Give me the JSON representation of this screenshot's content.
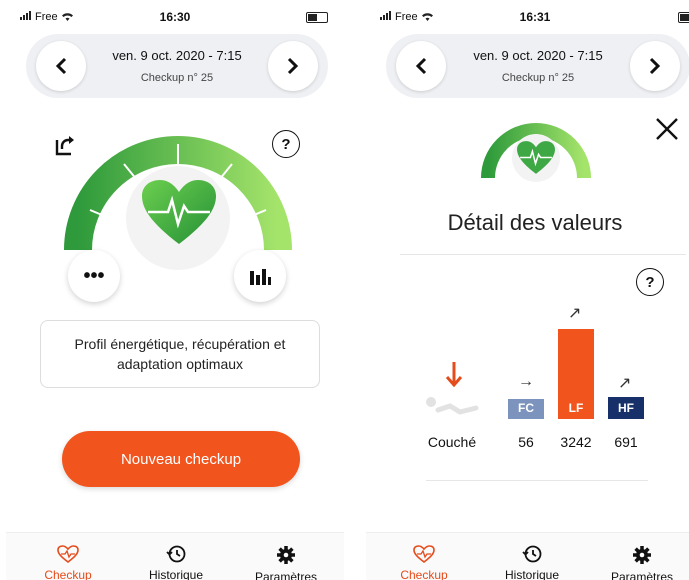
{
  "colors": {
    "accent": "#f2541d",
    "green_dark": "#2e9a3b",
    "green_light": "#9be267",
    "fc_blue": "#7b93bd",
    "hf_navy": "#17306a"
  },
  "screens": [
    {
      "status": {
        "carrier": "Free",
        "time": "16:30"
      },
      "header": {
        "date": "ven. 9 oct. 2020 - 7:15",
        "checkup": "Checkup n° 25",
        "prev_icon": "chevron-left-icon",
        "next_icon": "chevron-right-icon"
      },
      "share_icon": "share-icon",
      "help_label": "?",
      "more_label": "•••",
      "chart_icon": "bar-chart-icon",
      "message": "Profil énergétique, récupération et adaptation optimaux",
      "cta_label": "Nouveau checkup",
      "tabs": [
        {
          "label": "Checkup",
          "icon": "heart-icon"
        },
        {
          "label": "Historique",
          "icon": "history-icon"
        },
        {
          "label": "Paramètres",
          "icon": "gear-icon"
        }
      ]
    },
    {
      "status": {
        "carrier": "Free",
        "time": "16:31"
      },
      "header": {
        "date": "ven. 9 oct. 2020 - 7:15",
        "checkup": "Checkup n° 25"
      },
      "title": "Détail des valeurs",
      "help_label": "?",
      "close_icon": "close-icon",
      "position_label": "Couché",
      "metrics": [
        {
          "label": "FC",
          "value": "56",
          "trend": "→",
          "level": 0.14
        },
        {
          "label": "LF",
          "value": "3242",
          "trend": "↗",
          "level": 1.0
        },
        {
          "label": "HF",
          "value": "691",
          "trend": "↗",
          "level": 0.08
        }
      ],
      "tabs": [
        {
          "label": "Checkup",
          "icon": "heart-icon"
        },
        {
          "label": "Historique",
          "icon": "history-icon"
        },
        {
          "label": "Paramètres",
          "icon": "gear-icon"
        }
      ]
    }
  ]
}
